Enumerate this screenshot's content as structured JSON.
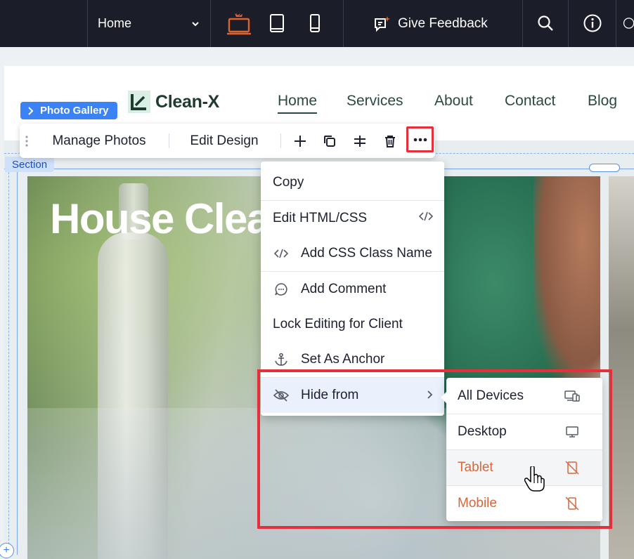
{
  "topbar": {
    "page_selector": "Home",
    "devices": [
      "desktop-icon",
      "tablet-icon",
      "mobile-icon"
    ],
    "feedback_label": "Give Feedback",
    "icons": [
      "search-icon",
      "info-icon"
    ]
  },
  "site": {
    "logo_text": "Clean-X",
    "nav": [
      "Home",
      "Services",
      "About",
      "Contact",
      "Blog"
    ],
    "active_nav": "Home",
    "hero_headline": "House Clea"
  },
  "selection": {
    "component_tag": "Photo Gallery",
    "section_tag": "Section"
  },
  "toolbar": {
    "manage_photos": "Manage Photos",
    "edit_design": "Edit Design",
    "icons": [
      "plus-icon",
      "duplicate-icon",
      "distribute-icon",
      "trash-icon",
      "more-icon"
    ]
  },
  "context_menu": {
    "items": [
      {
        "label": "Copy",
        "icon": ""
      },
      {
        "label": "Edit HTML/CSS",
        "icon": "code-icon"
      },
      {
        "label": "Add CSS Class Name",
        "icon": "code-icon"
      },
      {
        "label": "Add Comment",
        "icon": "comment-icon"
      },
      {
        "label": "Lock Editing for Client",
        "icon": ""
      },
      {
        "label": "Set As Anchor",
        "icon": "anchor-icon"
      },
      {
        "label": "Hide from",
        "icon": "eye-off-icon"
      }
    ]
  },
  "hide_submenu": {
    "items": [
      {
        "label": "All Devices",
        "icon": "multi-device-icon",
        "hidden": false
      },
      {
        "label": "Desktop",
        "icon": "desktop-icon",
        "hidden": false
      },
      {
        "label": "Tablet",
        "icon": "tablet-hidden-icon",
        "hidden": true
      },
      {
        "label": "Mobile",
        "icon": "mobile-hidden-icon",
        "hidden": true
      }
    ]
  },
  "colors": {
    "editor_bar": "#1b1e28",
    "accent_orange": "#e0622f",
    "selection_blue": "#3b82f6",
    "highlight_red": "#e5303b",
    "brand_green": "#1d3b2f"
  }
}
